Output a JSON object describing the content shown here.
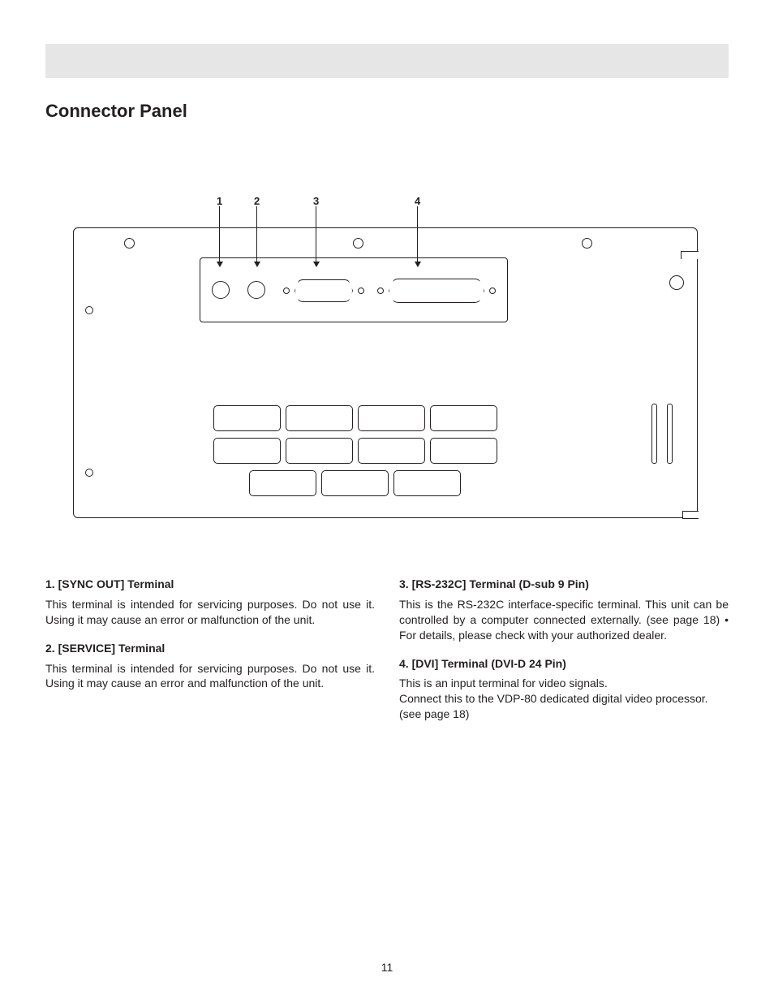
{
  "section_title": "Connector Panel",
  "callouts": {
    "n1": "1",
    "n2": "2",
    "n3": "3",
    "n4": "4"
  },
  "left": {
    "item1": {
      "head": "1. [SYNC OUT] Terminal",
      "body": "This terminal is intended for servicing purposes. Do not use it. Using it may cause an error or malfunction of the unit."
    },
    "item2": {
      "head": "2. [SERVICE] Terminal",
      "body": "This terminal is intended for servicing purposes. Do not use it. Using it may cause an error and malfunction of the unit."
    }
  },
  "right": {
    "item3": {
      "head": "3. [RS-232C] Terminal (D-sub 9 Pin)",
      "body": "This is the RS-232C interface-specific terminal. This unit can be controlled by a computer connected externally. (see page 18) • For details, please check with your authorized dealer."
    },
    "item4": {
      "head": "4. [DVI] Terminal (DVI-D 24 Pin)",
      "body_l1": "This is an input terminal for video signals.",
      "body_l2": "Connect this to the VDP-80 dedicated digital video processor.",
      "body_l3": "(see page 18)"
    }
  },
  "page_number": "11"
}
